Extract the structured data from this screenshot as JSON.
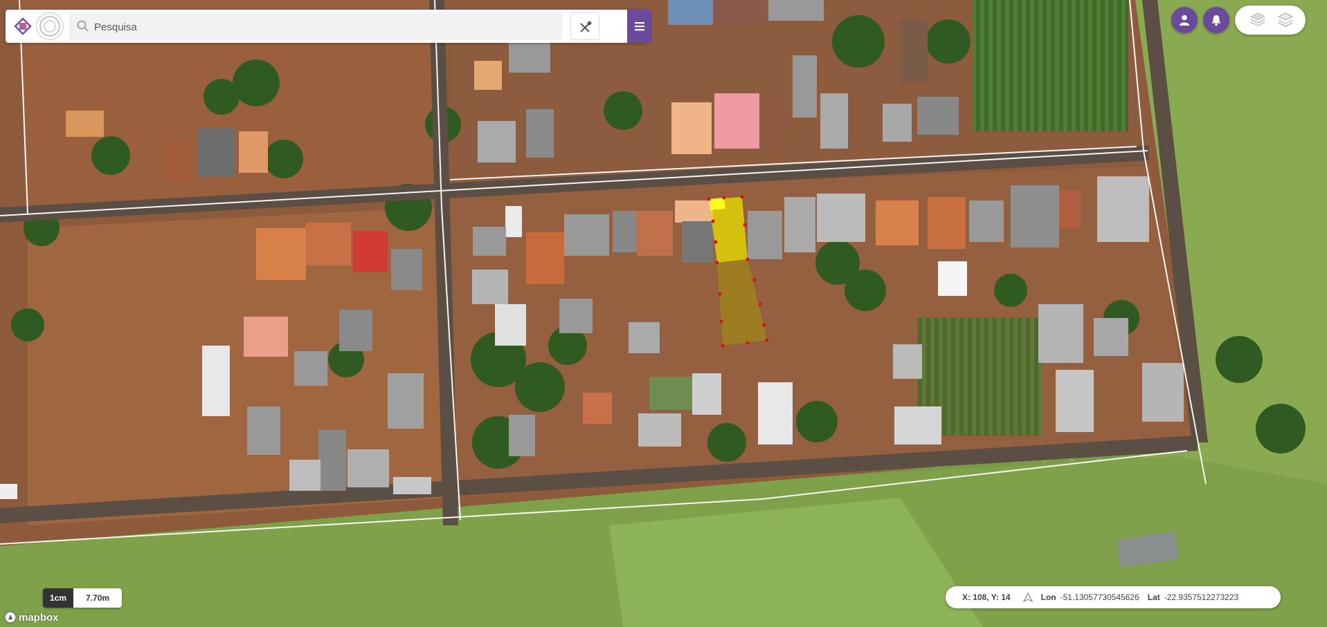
{
  "search": {
    "placeholder": "Pesquisa"
  },
  "toolbar": {
    "tools_icon": "tools-icon",
    "menu_icon": "hamburger-menu-icon"
  },
  "top_right": {
    "user_icon": "user-icon",
    "notification_icon": "bell-icon",
    "layers": [
      "layers-stack-icon",
      "layers-stack-icon"
    ]
  },
  "scale": {
    "label": "1cm",
    "value": "7.70m"
  },
  "attribution": {
    "text": "mapbox"
  },
  "coords": {
    "xy_label": "X: 108, Y: 14",
    "lon_label": "Lon",
    "lon_value": "-51.13057730545626",
    "lat_label": "Lat",
    "lat_value": "-22.9357512273223"
  },
  "colors": {
    "brand": "#6b4a9e",
    "highlight_parcel": "#e8e000",
    "vertex": "#e01010"
  }
}
